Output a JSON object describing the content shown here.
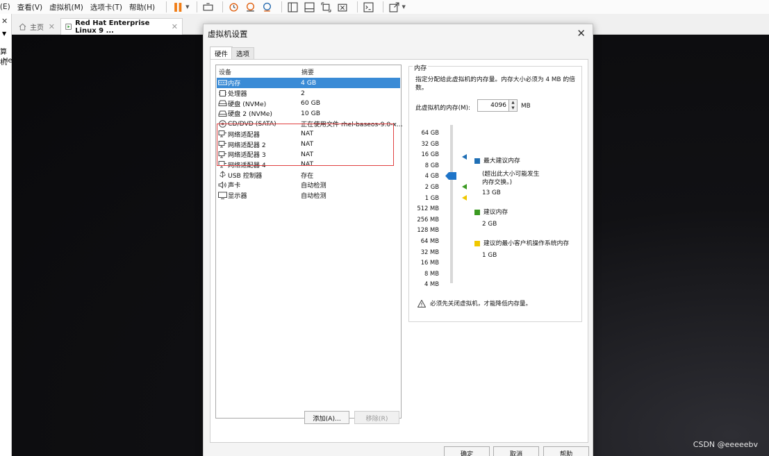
{
  "menu": [
    "l(E)",
    "查看(V)",
    "虚拟机(M)",
    "选项卡(T)",
    "帮助(H)"
  ],
  "toolbar_icons": [
    "pause-icon",
    "send-keys-icon",
    "snapshot-icon",
    "revert-snapshot-icon",
    "manage-snapshots-icon",
    "normal-view-icon",
    "fullscreen-view-icon",
    "unity-icon",
    "stretch-icon",
    "console-icon",
    "autofit-icon"
  ],
  "left_strip": {
    "text1": "算机",
    "text2": "He"
  },
  "tabs": {
    "home": "主页",
    "vm": "Red Hat Enterprise Linux 9 ..."
  },
  "dialog": {
    "title": "虚拟机设置",
    "tab_hardware": "硬件",
    "tab_options": "选项",
    "device_header": {
      "device": "设备",
      "summary": "摘要"
    },
    "devices": [
      {
        "icon": "memory-icon",
        "name": "内存",
        "summary": "4 GB",
        "selected": true
      },
      {
        "icon": "cpu-icon",
        "name": "处理器",
        "summary": "2",
        "selected": false
      },
      {
        "icon": "disk-icon",
        "name": "硬盘 (NVMe)",
        "summary": "60 GB",
        "selected": false
      },
      {
        "icon": "disk-icon",
        "name": "硬盘 2 (NVMe)",
        "summary": "10 GB",
        "selected": false
      },
      {
        "icon": "cd-icon",
        "name": "CD/DVD (SATA)",
        "summary": "正在使用文件 rhel-baseos-9.0-x...",
        "selected": false
      },
      {
        "icon": "network-icon",
        "name": "网络适配器",
        "summary": "NAT",
        "selected": false
      },
      {
        "icon": "network-icon",
        "name": "网络适配器 2",
        "summary": "NAT",
        "selected": false
      },
      {
        "icon": "network-icon",
        "name": "网络适配器 3",
        "summary": "NAT",
        "selected": false
      },
      {
        "icon": "network-icon",
        "name": "网络适配器 4",
        "summary": "NAT",
        "selected": false
      },
      {
        "icon": "usb-icon",
        "name": "USB 控制器",
        "summary": "存在",
        "selected": false
      },
      {
        "icon": "speaker-icon",
        "name": "声卡",
        "summary": "自动检测",
        "selected": false
      },
      {
        "icon": "monitor-icon",
        "name": "显示器",
        "summary": "自动检测",
        "selected": false
      }
    ],
    "add_button": "添加(A)...",
    "remove_button": "移除(R)",
    "ok_button": "确定",
    "cancel_button": "取消",
    "help_button": "帮助",
    "memory": {
      "section_title": "内存",
      "description": "指定分配给此虚拟机的内存量。内存大小必须为 4 MB 的倍数。",
      "field_label": "此虚拟机的内存(M):",
      "value": "4096",
      "unit": "MB",
      "scale": [
        "64 GB",
        "32 GB",
        "16 GB",
        "8 GB",
        "4 GB",
        "2 GB",
        "1 GB",
        "512 MB",
        "256 MB",
        "128 MB",
        "64 MB",
        "32 MB",
        "16 MB",
        "8 MB",
        "4 MB"
      ],
      "current_level": "4 GB",
      "max_recommended": {
        "label": "最大建议内存",
        "note": "(超出此大小可能发生内存交换。)",
        "value": "13 GB",
        "color": "#1f6fb5"
      },
      "recommended": {
        "label": "建议内存",
        "value": "2 GB",
        "color": "#3b9a22"
      },
      "min_guest": {
        "label": "建议的最小客户机操作系统内存",
        "value": "1 GB",
        "color": "#f0c800"
      },
      "warning": "必须先关闭虚拟机，才能降低内存量。"
    }
  },
  "watermark": "CSDN @eeeeebv"
}
